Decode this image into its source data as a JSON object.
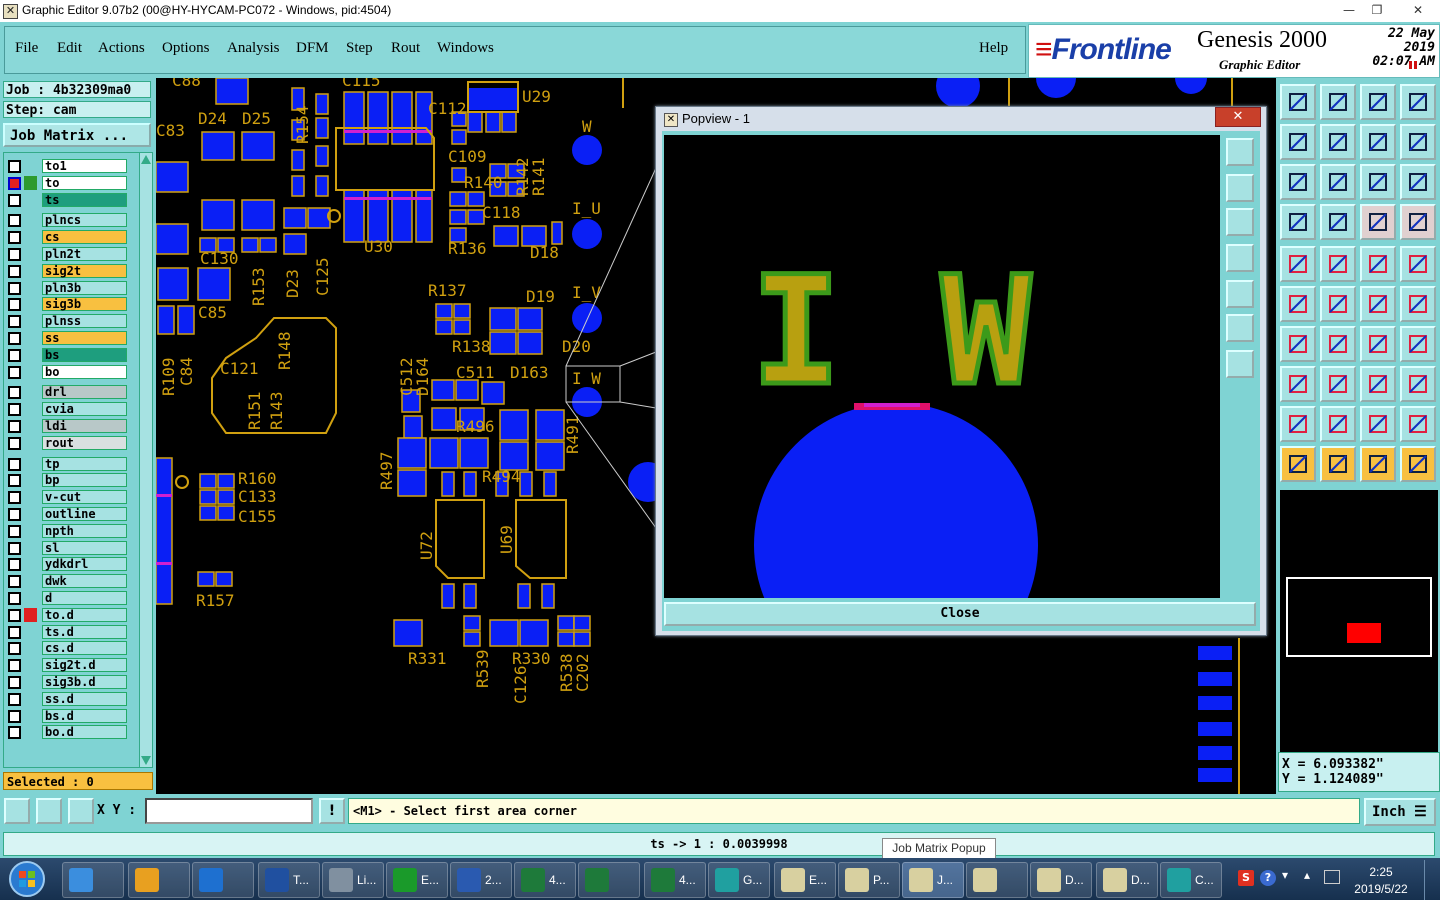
{
  "window": {
    "title": "Graphic Editor 9.07b2 (00@HY-HYCAM-PC072 - Windows, pid:4504)",
    "min": "—",
    "max": "❐",
    "close": "✕"
  },
  "menu": {
    "items": [
      "File",
      "Edit",
      "Actions",
      "Options",
      "Analysis",
      "DFM",
      "Step",
      "Rout",
      "Windows"
    ],
    "help": "Help"
  },
  "brand": {
    "logo": "Frontline",
    "product": "Genesis 2000",
    "subtitle": "Graphic Editor",
    "date": "22 May 2019",
    "time": "02:07 AM"
  },
  "job": {
    "job_label": "Job : 4b32309ma0",
    "step_label": "Step: cam",
    "job_matrix": "Job Matrix ..."
  },
  "layers": [
    {
      "name": "to1",
      "color": "#ffffff",
      "mark": ""
    },
    {
      "name": "to",
      "color": "#ffffff",
      "mark": "#2e9a2e",
      "flag": "✎▪",
      "active": true
    },
    {
      "name": "ts",
      "color": "#1e9e7e",
      "mark": ""
    },
    {
      "name": "plncs",
      "color": "#a6e2e2",
      "mark": ""
    },
    {
      "name": "cs",
      "color": "#f8c040",
      "mark": ""
    },
    {
      "name": "pln2t",
      "color": "#a6e2e2",
      "mark": ""
    },
    {
      "name": "sig2t",
      "color": "#f8c040",
      "mark": "",
      "flag": "✎"
    },
    {
      "name": "pln3b",
      "color": "#a6e2e2",
      "mark": ""
    },
    {
      "name": "sig3b",
      "color": "#f8c040",
      "mark": ""
    },
    {
      "name": "plnss",
      "color": "#a6e2e2",
      "mark": ""
    },
    {
      "name": "ss",
      "color": "#f8c040",
      "mark": ""
    },
    {
      "name": "bs",
      "color": "#1e9e7e",
      "mark": ""
    },
    {
      "name": "bo",
      "color": "#ffffff",
      "mark": "",
      "flag": "✎"
    },
    {
      "name": "drl",
      "color": "#b8c8c8",
      "mark": ""
    },
    {
      "name": "cvia",
      "color": "#a6e2e2",
      "mark": ""
    },
    {
      "name": "ldi",
      "color": "#b8c8c8",
      "mark": ""
    },
    {
      "name": "rout",
      "color": "#d8e0e0",
      "mark": ""
    },
    {
      "name": "tp",
      "color": "#a6e2e2",
      "mark": ""
    },
    {
      "name": "bp",
      "color": "#a6e2e2",
      "mark": ""
    },
    {
      "name": "v-cut",
      "color": "#a6e2e2",
      "mark": ""
    },
    {
      "name": "outline",
      "color": "#a6e2e2",
      "mark": ""
    },
    {
      "name": "npth",
      "color": "#a6e2e2",
      "mark": ""
    },
    {
      "name": "sl",
      "color": "#a6e2e2",
      "mark": ""
    },
    {
      "name": "ydkdrl",
      "color": "#a6e2e2",
      "mark": ""
    },
    {
      "name": "dwk",
      "color": "#a6e2e2",
      "mark": ""
    },
    {
      "name": "d",
      "color": "#a6e2e2",
      "mark": ""
    },
    {
      "name": "to.d",
      "color": "#a6e2e2",
      "mark": "#e02020",
      "flag": "✎"
    },
    {
      "name": "ts.d",
      "color": "#a6e2e2",
      "mark": ""
    },
    {
      "name": "cs.d",
      "color": "#a6e2e2",
      "mark": ""
    },
    {
      "name": "sig2t.d",
      "color": "#a6e2e2",
      "mark": "",
      "flag": "✎"
    },
    {
      "name": "sig3b.d",
      "color": "#a6e2e2",
      "mark": ""
    },
    {
      "name": "ss.d",
      "color": "#a6e2e2",
      "mark": ""
    },
    {
      "name": "bs.d",
      "color": "#a6e2e2",
      "mark": ""
    },
    {
      "name": "bo.d",
      "color": "#a6e2e2",
      "mark": "",
      "flag": "✎"
    }
  ],
  "selected": "Selected : 0",
  "popview": {
    "title": "Popview - 1",
    "close_x": "✕",
    "close_button": "Close",
    "text_left": "I",
    "text_right": "W"
  },
  "canvas_labels": [
    "C88",
    "C115",
    "U29",
    "C83",
    "D24",
    "D25",
    "R154",
    "C112",
    "W",
    "C109",
    "R140",
    "R142",
    "R141",
    "I_U",
    "C118",
    "R136",
    "D18",
    "C130",
    "R153",
    "D23",
    "C125",
    "U30",
    "R137",
    "D19",
    "I_V",
    "C85",
    "C121",
    "R148",
    "R138",
    "D20",
    "R109",
    "C84",
    "R151",
    "R143",
    "C512",
    "D164",
    "C511",
    "D163",
    "I W",
    "R496",
    "R491",
    "R497",
    "R494",
    "R160",
    "C133",
    "C155",
    "U72",
    "U69",
    "R157",
    "R331",
    "R539",
    "C126",
    "R330",
    "R538",
    "C202"
  ],
  "coords": {
    "x": "X = 6.093382\"",
    "y": "Y = 1.124089\""
  },
  "bottom": {
    "xy_label": "X Y :",
    "xy_value": "",
    "warn": "!",
    "message": "<M1> - Select first area corner",
    "unit": "Inch ☰"
  },
  "status": {
    "text": "ts -> 1 : 0.0039998",
    "tooltip": "Job Matrix Popup"
  },
  "taskbar": {
    "items": [
      {
        "label": "",
        "color": "#3b8ede"
      },
      {
        "label": "",
        "color": "#e8a020"
      },
      {
        "label": "",
        "color": "#1e70d0"
      },
      {
        "label": "T...",
        "color": "#2050a0"
      },
      {
        "label": "Li...",
        "color": "#8090a0"
      },
      {
        "label": "E...",
        "color": "#1a9a2a"
      },
      {
        "label": "2...",
        "color": "#2a5ab0"
      },
      {
        "label": "4...",
        "color": "#1e7a3a"
      },
      {
        "label": "",
        "color": "#1e7a3a"
      },
      {
        "label": "4...",
        "color": "#1e7a3a"
      },
      {
        "label": "G...",
        "color": "#20a0a0"
      },
      {
        "label": "E...",
        "color": "#d8d0a0"
      },
      {
        "label": "P...",
        "color": "#d8d0a0"
      },
      {
        "label": "J...",
        "color": "#d8d0a0"
      },
      {
        "label": "",
        "color": "#d8d0a0"
      },
      {
        "label": "D...",
        "color": "#d8d0a0"
      },
      {
        "label": "D...",
        "color": "#d8d0a0"
      },
      {
        "label": "C...",
        "color": "#20a0a0"
      }
    ],
    "clock_time": "2:25",
    "clock_date": "2019/5/22"
  }
}
